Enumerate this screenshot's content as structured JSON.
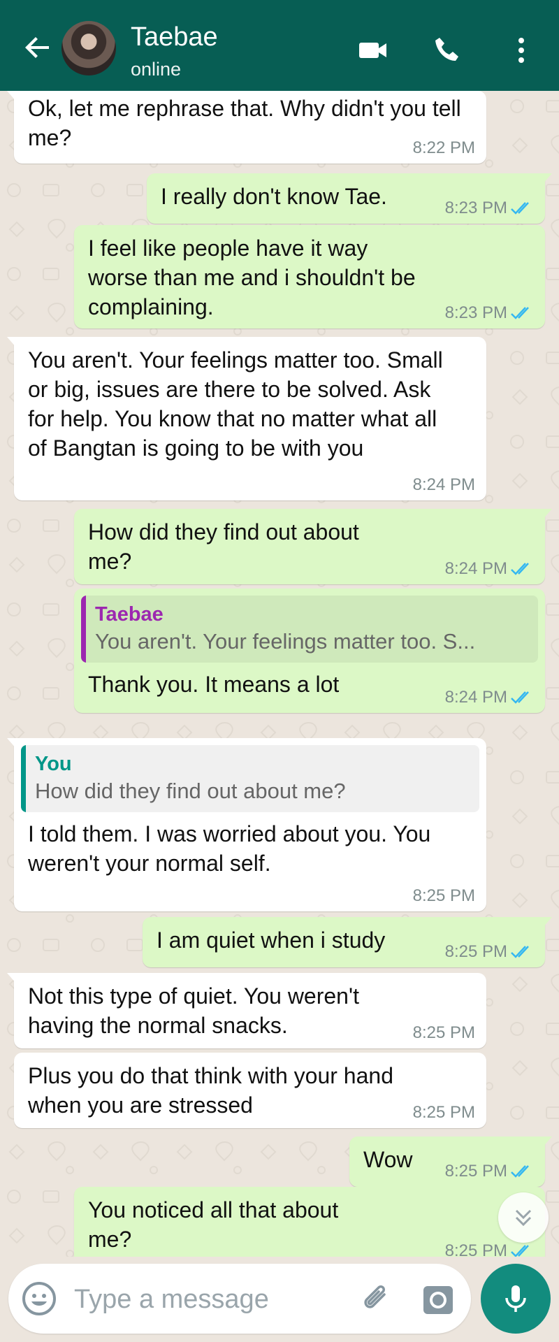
{
  "colors": {
    "header": "#075e54",
    "incoming_bubble": "#ffffff",
    "outgoing_bubble": "#dcf8c6",
    "background": "#ece5dd",
    "read_tick": "#34b7f1",
    "mic_button": "#128c7e",
    "quote_you": "#009688",
    "quote_contact": "#9c27b0"
  },
  "header": {
    "contact_name": "Taebae",
    "status": "online",
    "icons": [
      "back-arrow-icon",
      "video-call-icon",
      "voice-call-icon",
      "more-options-icon"
    ]
  },
  "messages": [
    {
      "dir": "in",
      "text": "Ok, let me rephrase that. Why didn't you tell me?",
      "time": "8:22 PM"
    },
    {
      "dir": "out",
      "text": "I really don't know Tae.",
      "time": "8:23 PM",
      "status": "read"
    },
    {
      "dir": "out",
      "text": "I feel like people have it way worse than me and i shouldn't be complaining.",
      "time": "8:23 PM",
      "status": "read"
    },
    {
      "dir": "in",
      "text": "You aren't. Your feelings matter too. Small or big, issues are there to be solved. Ask for help. You know that no matter what all of Bangtan is going to be with you",
      "time": "8:24 PM"
    },
    {
      "dir": "out",
      "text": "How did they find out about me?",
      "time": "8:24 PM",
      "status": "read"
    },
    {
      "dir": "out",
      "quote_author": "Taebae",
      "quote_text": "You aren't. Your feelings matter too. S...",
      "text": "Thank you. It means a lot",
      "time": "8:24 PM",
      "status": "read"
    },
    {
      "dir": "in",
      "quote_author": "You",
      "quote_text": "How did they find out about me?",
      "text": "I told them. I was worried about you. You weren't your normal self.",
      "time": "8:25 PM"
    },
    {
      "dir": "out",
      "text": "I am quiet when i study",
      "time": "8:25 PM",
      "status": "read"
    },
    {
      "dir": "in",
      "text": "Not this type of quiet. You weren't having the normal snacks.",
      "time": "8:25 PM"
    },
    {
      "dir": "in",
      "text": "Plus you do that think with your hand when you are stressed",
      "time": "8:25 PM"
    },
    {
      "dir": "out",
      "text": "Wow",
      "time": "8:25 PM",
      "status": "read"
    },
    {
      "dir": "out",
      "text": "You noticed all that about me?",
      "time": "8:25 PM",
      "status": "read"
    }
  ],
  "composer": {
    "placeholder": "Type a message",
    "value": "",
    "icons": [
      "emoji-icon",
      "attach-icon",
      "camera-icon",
      "mic-icon"
    ]
  },
  "scroll_button_icon": "double-chevron-down-icon"
}
